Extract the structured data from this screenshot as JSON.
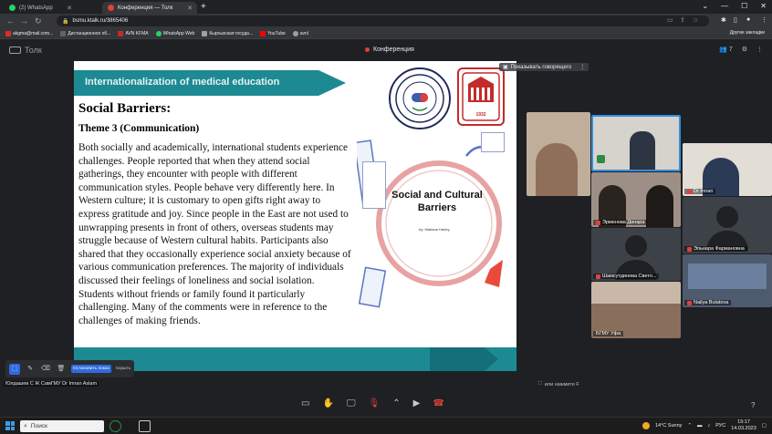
{
  "browser": {
    "tabs": [
      {
        "label": "(2) WhatsApp",
        "color": "#25d366",
        "active": false
      },
      {
        "label": "Конференция — Толк",
        "color": "#e0413b",
        "active": true
      }
    ],
    "url": "bsmu.ktalk.ru/3865406",
    "bookmarks": [
      {
        "label": "akgma@mail.com...",
        "color": "#d93025"
      },
      {
        "label": "Дистанционное об...",
        "color": "#5f6368"
      },
      {
        "label": "AVN KFMA",
        "color": "#c62828"
      },
      {
        "label": "WhatsApp Web",
        "color": "#25d366"
      },
      {
        "label": "Кыргызская госуда...",
        "color": "#9aa0a6"
      },
      {
        "label": "YouTube",
        "color": "#ff0000"
      },
      {
        "label": "avn/",
        "color": "#9aa0a6"
      }
    ],
    "other_bookmarks": "Другие закладки"
  },
  "app": {
    "logo": "Толк",
    "conference_title": "Конференция",
    "participants_count": "7",
    "show_speaker": "Показывать говорящего"
  },
  "slide": {
    "banner": "Internationalization of medical education",
    "heading": "Social Barriers:",
    "subheading": "Theme 3 (Communication)",
    "body": "Both socially and academically, international students experience challenges. People reported that when they attend social gatherings, they encounter with people with different communication styles. People behave very differently here. In Western culture; it is customary to open gifts right away to express gratitude and joy. Since people in the East are not used to unwrapping presents in front of others, overseas students may struggle because of Western cultural habits. Participants also shared that they occasionally experience social anxiety because of various communication preferences. The majority of individuals discussed their feelings of loneliness and social isolation. Students without friends or family found it particularly challenging. Many of the comments were in reference to the challenges of making friends.",
    "diagram_title": "Social and Cultural Barriers",
    "diagram_by": "by: Mariana Harley",
    "seal_year": "1932"
  },
  "participants": [
    {
      "name": "",
      "muted": false
    },
    {
      "name": "",
      "muted": false
    },
    {
      "name": "Dr Imran",
      "muted": false
    },
    {
      "name": "Эрменова Динара",
      "muted": true
    },
    {
      "name": "Эльнара Фармановна",
      "muted": true
    },
    {
      "name": "Шамсутдинова Светл...",
      "muted": true
    },
    {
      "name": "Nailya Bulatova",
      "muted": false
    },
    {
      "name": "БГМУ Уфа",
      "muted": false
    }
  ],
  "annotation": {
    "stop_pointer": "Остановить показ",
    "hide": "Скрыть"
  },
  "presenter_label": "Юлдашев С Ж СамГМУ Dr Imran Aslam",
  "fullscreen_hint": "или нажмите F",
  "taskbar": {
    "search_placeholder": "Поиск",
    "weather": "14°C  Sunny",
    "lang": "РУС",
    "time": "15:17",
    "date": "14.03.2023"
  }
}
